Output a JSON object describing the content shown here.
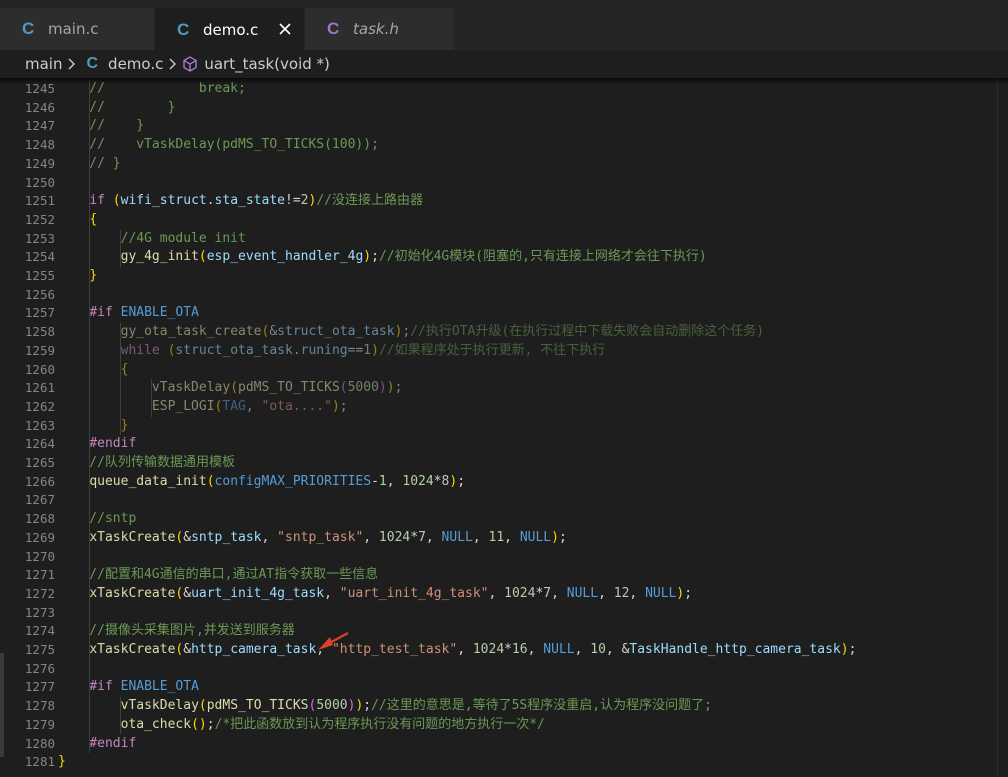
{
  "tabs": [
    {
      "icon": "C",
      "label": "main.c",
      "active": false,
      "italic": false
    },
    {
      "icon": "C",
      "label": "demo.c",
      "active": true,
      "italic": false
    },
    {
      "icon": "C",
      "label": "task.h",
      "active": false,
      "italic": true
    }
  ],
  "breadcrumb": {
    "folder": "main",
    "file": "demo.c",
    "symbol": "uart_task(void *)"
  },
  "colors": {
    "c_icon_main": "#519aba",
    "c_icon_task": "#a074c4",
    "arrow": "#e0402a",
    "comment": "#6a9955",
    "keyword": "#569cd6",
    "function": "#dcdcaa",
    "string": "#ce9178"
  },
  "lines": [
    {
      "n": "1245",
      "text": "    //            break;"
    },
    {
      "n": "1246",
      "text": "    //        }"
    },
    {
      "n": "1247",
      "text": "    //    }"
    },
    {
      "n": "1248",
      "text": "    //    vTaskDelay(pdMS_TO_TICKS(100));"
    },
    {
      "n": "1249",
      "text": "    // }"
    },
    {
      "n": "1250",
      "text": ""
    },
    {
      "n": "1251",
      "text": "    if (wifi_struct.sta_state!=2)//没连接上路由器"
    },
    {
      "n": "1252",
      "text": "    {"
    },
    {
      "n": "1253",
      "text": "        //4G module init"
    },
    {
      "n": "1254",
      "text": "        gy_4g_init(esp_event_handler_4g);//初始化4G模块(阻塞的,只有连接上网络才会往下执行)"
    },
    {
      "n": "1255",
      "text": "    }"
    },
    {
      "n": "1256",
      "text": ""
    },
    {
      "n": "1257",
      "text": "    #if ENABLE_OTA"
    },
    {
      "n": "1258",
      "text": "        gy_ota_task_create(&struct_ota_task);//执行OTA升级(在执行过程中下载失败会自动删除这个任务)"
    },
    {
      "n": "1259",
      "text": "        while (struct_ota_task.runing==1)//如果程序处于执行更新, 不往下执行"
    },
    {
      "n": "1260",
      "text": "        {"
    },
    {
      "n": "1261",
      "text": "            vTaskDelay(pdMS_TO_TICKS(5000));"
    },
    {
      "n": "1262",
      "text": "            ESP_LOGI(TAG, \"ota....\");"
    },
    {
      "n": "1263",
      "text": "        }"
    },
    {
      "n": "1264",
      "text": "    #endif"
    },
    {
      "n": "1265",
      "text": "    //队列传输数据通用模板"
    },
    {
      "n": "1266",
      "text": "    queue_data_init(configMAX_PRIORITIES-1, 1024*8);"
    },
    {
      "n": "1267",
      "text": ""
    },
    {
      "n": "1268",
      "text": "    //sntp"
    },
    {
      "n": "1269",
      "text": "    xTaskCreate(&sntp_task, \"sntp_task\", 1024*7, NULL, 11, NULL);"
    },
    {
      "n": "1270",
      "text": ""
    },
    {
      "n": "1271",
      "text": "    //配置和4G通信的串口,通过AT指令获取一些信息"
    },
    {
      "n": "1272",
      "text": "    xTaskCreate(&uart_init_4g_task, \"uart_init_4g_task\", 1024*7, NULL, 12, NULL);"
    },
    {
      "n": "1273",
      "text": ""
    },
    {
      "n": "1274",
      "text": "    //摄像头采集图片,并发送到服务器"
    },
    {
      "n": "1275",
      "text": "    xTaskCreate(&http_camera_task, \"http_test_task\", 1024*16, NULL, 10, &TaskHandle_http_camera_task);"
    },
    {
      "n": "1276",
      "text": ""
    },
    {
      "n": "1277",
      "text": "    #if ENABLE_OTA"
    },
    {
      "n": "1278",
      "text": "        vTaskDelay(pdMS_TO_TICKS(5000));//这里的意思是,等待了5S程序没重启,认为程序没问题了;"
    },
    {
      "n": "1279",
      "text": "        ota_check();/*把此函数放到认为程序执行没有问题的地方执行一次*/"
    },
    {
      "n": "1280",
      "text": "    #endif"
    },
    {
      "n": "1281",
      "text": "}"
    }
  ]
}
